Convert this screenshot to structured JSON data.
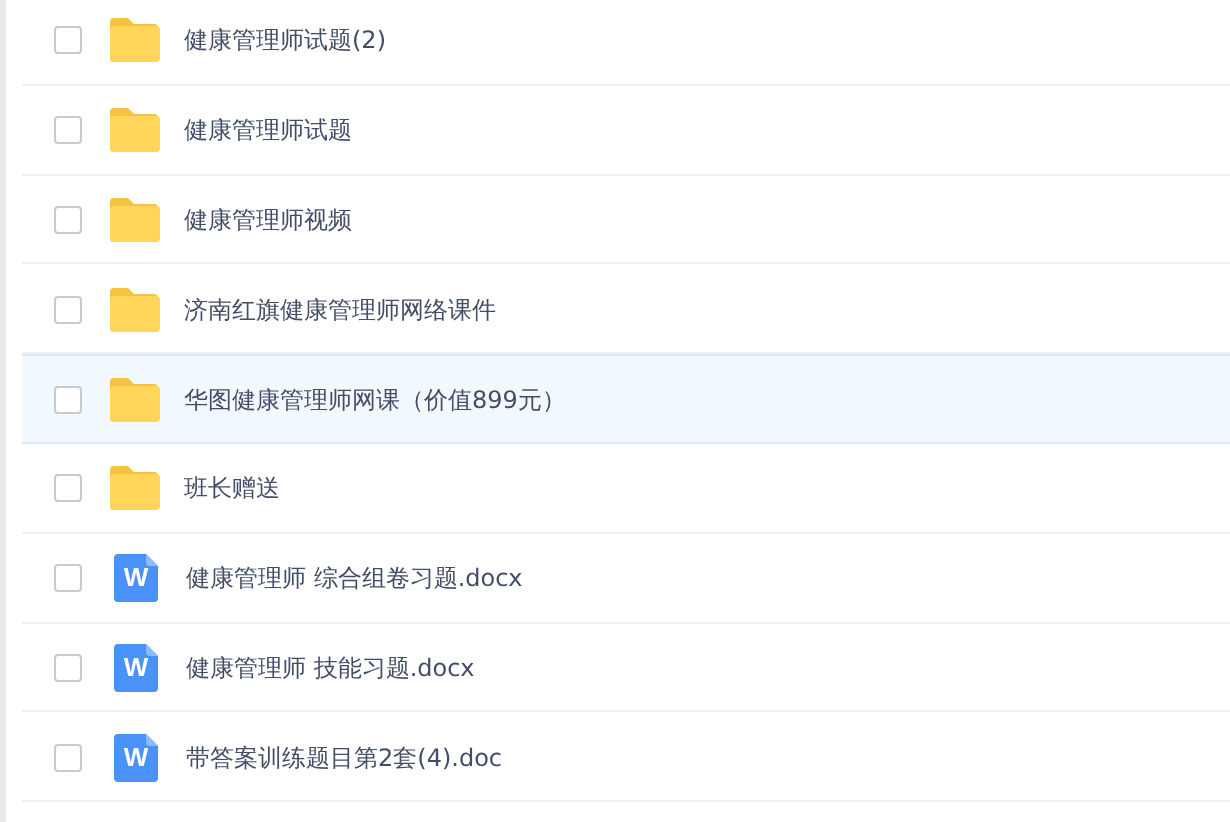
{
  "files": [
    {
      "kind": "folder",
      "name": "健康管理师试题(2)",
      "checked": false,
      "highlighted": false
    },
    {
      "kind": "folder",
      "name": "健康管理师试题",
      "checked": false,
      "highlighted": false
    },
    {
      "kind": "folder",
      "name": "健康管理师视频",
      "checked": false,
      "highlighted": false
    },
    {
      "kind": "folder",
      "name": "济南红旗健康管理师网络课件",
      "checked": false,
      "highlighted": false
    },
    {
      "kind": "folder",
      "name": "华图健康管理师网课（价值899元）",
      "checked": false,
      "highlighted": true
    },
    {
      "kind": "folder",
      "name": "班长赠送",
      "checked": false,
      "highlighted": false
    },
    {
      "kind": "doc",
      "icon_letter": "W",
      "name": "健康管理师 综合组卷习题.docx",
      "checked": false,
      "highlighted": false
    },
    {
      "kind": "doc",
      "icon_letter": "W",
      "name": "健康管理师 技能习题.docx",
      "checked": false,
      "highlighted": false
    },
    {
      "kind": "doc",
      "icon_letter": "W",
      "name": "带答案训练题目第2套(4).doc",
      "checked": false,
      "highlighted": false
    }
  ]
}
